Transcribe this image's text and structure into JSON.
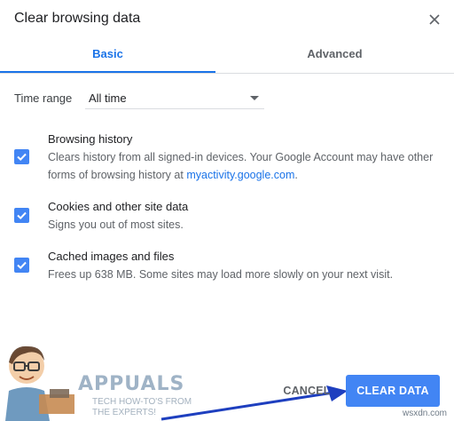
{
  "dialog": {
    "title": "Clear browsing data",
    "close_icon": "close-icon"
  },
  "tabs": [
    {
      "label": "Basic",
      "selected": true
    },
    {
      "label": "Advanced",
      "selected": false
    }
  ],
  "time_range": {
    "label": "Time range",
    "value": "All time"
  },
  "items": [
    {
      "title": "Browsing history",
      "checked": true,
      "description": "Clears history from all signed-in devices. Your Google Account may have other forms of browsing history at",
      "link": "myactivity.google.com",
      "suffix": "."
    },
    {
      "title": "Cookies and other site data",
      "checked": true,
      "description": "Signs you out of most sites."
    },
    {
      "title": "Cached images and files",
      "checked": true,
      "description": "Frees up 638 MB. Some sites may load more slowly on your next visit."
    }
  ],
  "buttons": {
    "cancel": "CANCEL",
    "clear": "CLEAR DATA"
  },
  "watermark": {
    "name": "APPUALS",
    "tagline_1": "TECH HOW-TO'S FROM",
    "tagline_2": "THE EXPERTS!",
    "site": "wsxdn.com"
  },
  "colors": {
    "accent": "#4285f4",
    "tab_active": "#1a73e8",
    "arrow": "#1e3fbf"
  }
}
